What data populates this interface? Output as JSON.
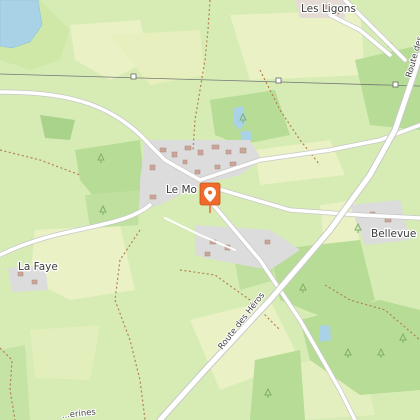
{
  "map": {
    "places": {
      "les_ligons": "Les Ligons",
      "le_mont": "Le Mo",
      "bellevue": "Bellevue",
      "la_faye": "La Faye"
    },
    "roads": {
      "route_des_heros": "Route des Héros",
      "route_des_top_right": "Route des",
      "bottom_left_partial": "...erines"
    },
    "marker": {
      "type": "location-pin",
      "color": "#ef6a2b"
    },
    "colors": {
      "land": "#d6ecb4",
      "meadow": "#eaf1c4",
      "forest": "#b6dc96",
      "water": "#a9d2e6",
      "road": "#ffffff",
      "residential": "#dcdcdc",
      "building": "#c9a699",
      "track": "#b5804e"
    }
  }
}
